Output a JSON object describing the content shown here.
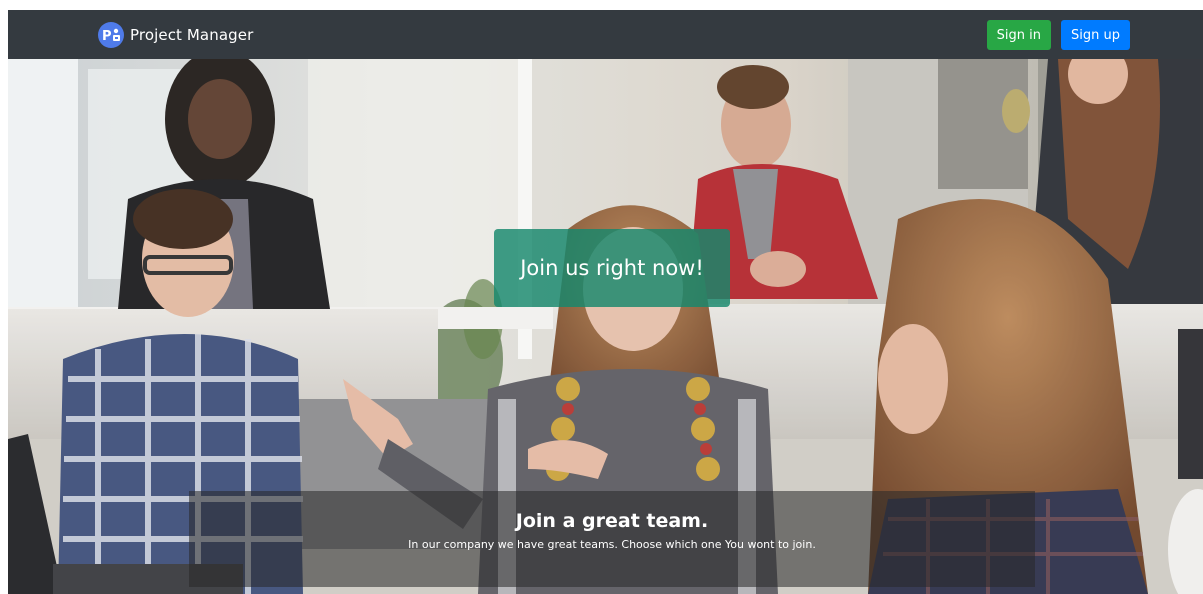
{
  "navbar": {
    "brand_text": "Project Manager",
    "brand_icon": "project-manager-logo-icon",
    "sign_in_label": "Sign in",
    "sign_up_label": "Sign up"
  },
  "hero": {
    "cta_label": "Join us right now!",
    "caption_title": "Join a great team.",
    "caption_text": "In our company we have great teams. Choose which one You wont to join."
  },
  "colors": {
    "navbar_bg": "#343a40",
    "sign_in_bg": "#28a745",
    "sign_up_bg": "#007bff",
    "cta_bg": "#16886c"
  }
}
